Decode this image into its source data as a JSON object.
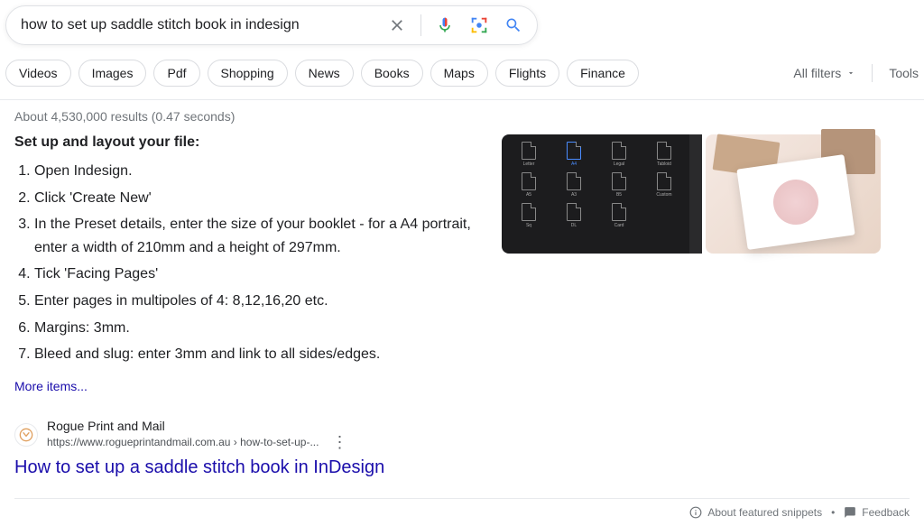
{
  "search": {
    "query": "how to set up saddle stitch book in indesign"
  },
  "chips": [
    "Videos",
    "Images",
    "Pdf",
    "Shopping",
    "News",
    "Books",
    "Maps",
    "Flights",
    "Finance"
  ],
  "filters": {
    "all_filters": "All filters",
    "tools": "Tools"
  },
  "stats": "About 4,530,000 results (0.47 seconds)",
  "snippet": {
    "heading": "Set up and layout your file:",
    "steps": [
      "Open Indesign.",
      "Click 'Create New'",
      "In the Preset details, enter the size of your booklet - for a A4 portrait, enter a width of 210mm and a height of 297mm.",
      "Tick 'Facing Pages'",
      "Enter pages in multipoles of 4: 8,12,16,20 etc.",
      "Margins: 3mm.",
      "Bleed and slug: enter 3mm and link to all sides/edges."
    ],
    "more": "More items..."
  },
  "result": {
    "source_name": "Rogue Print and Mail",
    "source_url": "https://www.rogueprintandmail.com.au › how-to-set-up-...",
    "title": "How to set up a saddle stitch book in InDesign"
  },
  "footer": {
    "about": "About featured snippets",
    "feedback": "Feedback"
  }
}
